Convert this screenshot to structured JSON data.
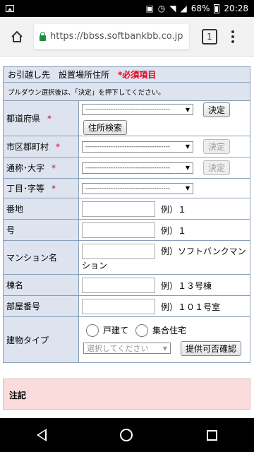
{
  "status_bar": {
    "battery": "68%",
    "time": "20:28"
  },
  "browser": {
    "url": "https://bbss.softbankbb.co.jp",
    "tab_count": "1"
  },
  "form": {
    "title": "お引越し先　設置場所住所",
    "required": "*必須項目",
    "note": "プルダウン選択後は、「決定」を押下してください。",
    "select_placeholder": "-------------------------------------",
    "confirm_label": "決定",
    "address_search_label": "住所検索",
    "rows": {
      "prefecture": {
        "label": "都道府県",
        "star": "*"
      },
      "city": {
        "label": "市区郡町村",
        "star": "*"
      },
      "district": {
        "label": "通称･大字",
        "star": "*"
      },
      "chome": {
        "label": "丁目･字等",
        "star": "*"
      },
      "banchi": {
        "label": "番地",
        "example": "例）１"
      },
      "go": {
        "label": "号",
        "example": "例）１"
      },
      "mansion": {
        "label": "マンション名",
        "example": "例）ソフトバンクマンション"
      },
      "building": {
        "label": "棟名",
        "example": "例）１３号棟"
      },
      "room": {
        "label": "部屋番号",
        "example": "例）１０１号室"
      },
      "building_type": {
        "label": "建物タイプ",
        "option_house": "戸建て",
        "option_apartment": "集合住宅",
        "select_placeholder": "選択してください",
        "check_button": "提供可否確認"
      }
    }
  },
  "notes": {
    "title": "注記"
  }
}
